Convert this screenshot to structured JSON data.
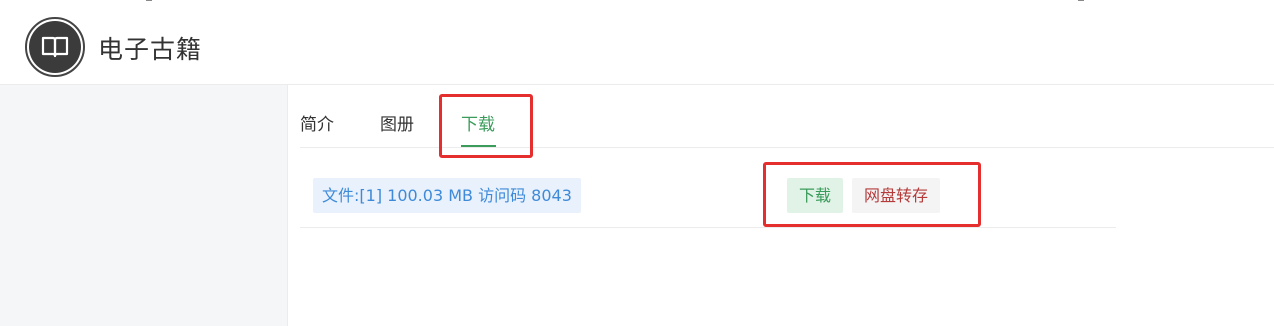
{
  "header": {
    "site_title": "电子古籍",
    "logo_icon": "book-icon"
  },
  "tabs": [
    {
      "label": "简介",
      "active": false
    },
    {
      "label": "图册",
      "active": false
    },
    {
      "label": "下载",
      "active": true
    }
  ],
  "downloads": {
    "file_label": "文件:[1] 100.03 MB 访问码 8043",
    "download_button": "下载",
    "save_to_pan_button": "网盘转存"
  },
  "colors": {
    "accent": "#3a9b5b",
    "link": "#3f8ad8",
    "annotation": "#e52e2e",
    "danger_text": "#b53b3b"
  }
}
